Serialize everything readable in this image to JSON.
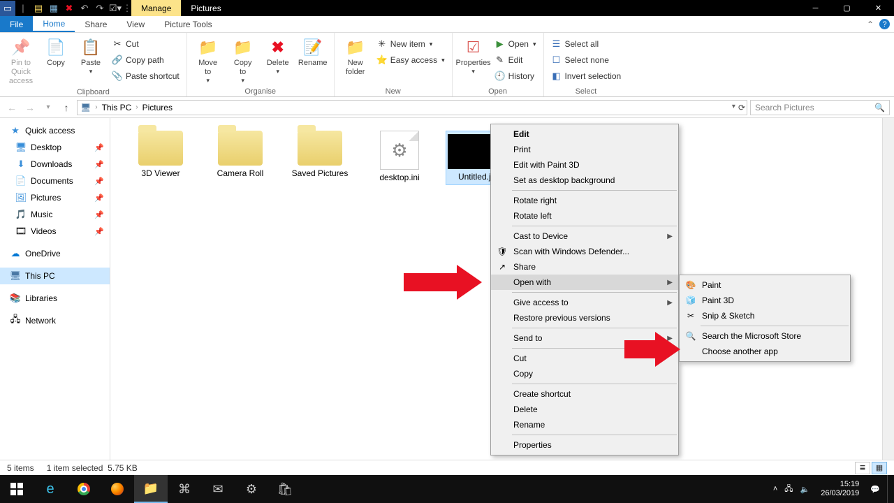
{
  "titlebar": {
    "context_group": "Manage",
    "title": "Pictures"
  },
  "menutabs": {
    "file": "File",
    "tabs": [
      "Home",
      "Share",
      "View",
      "Picture Tools"
    ],
    "active": "Home"
  },
  "ribbon": {
    "clipboard": {
      "title": "Clipboard",
      "pin": "Pin to Quick\naccess",
      "copy": "Copy",
      "paste": "Paste",
      "cut": "Cut",
      "copy_path": "Copy path",
      "paste_shortcut": "Paste shortcut"
    },
    "organise": {
      "title": "Organise",
      "move_to": "Move\nto",
      "copy_to": "Copy\nto",
      "delete": "Delete",
      "rename": "Rename"
    },
    "new": {
      "title": "New",
      "new_folder": "New\nfolder",
      "new_item": "New item",
      "easy_access": "Easy access"
    },
    "open": {
      "title": "Open",
      "properties": "Properties",
      "open": "Open",
      "edit": "Edit",
      "history": "History"
    },
    "select": {
      "title": "Select",
      "select_all": "Select all",
      "select_none": "Select none",
      "invert": "Invert selection"
    }
  },
  "address": {
    "crumbs": [
      "This PC",
      "Pictures"
    ],
    "search_placeholder": "Search Pictures"
  },
  "sidebar": {
    "quick_access": "Quick access",
    "items": [
      {
        "label": "Desktop",
        "icon": "🖥",
        "pin": true
      },
      {
        "label": "Downloads",
        "icon": "⬇",
        "pin": true
      },
      {
        "label": "Documents",
        "icon": "📄",
        "pin": true
      },
      {
        "label": "Pictures",
        "icon": "🖼",
        "pin": true
      },
      {
        "label": "Music",
        "icon": "🎵",
        "pin": true
      },
      {
        "label": "Videos",
        "icon": "🎞",
        "pin": true
      }
    ],
    "onedrive": "OneDrive",
    "this_pc": "This PC",
    "libraries": "Libraries",
    "network": "Network"
  },
  "files": {
    "items": [
      {
        "label": "3D Viewer",
        "type": "folder"
      },
      {
        "label": "Camera Roll",
        "type": "folder"
      },
      {
        "label": "Saved Pictures",
        "type": "folder"
      },
      {
        "label": "desktop.ini",
        "type": "file-gear"
      },
      {
        "label": "Untitled.jpg",
        "type": "image",
        "selected": true
      }
    ]
  },
  "context_menu": {
    "items": [
      {
        "label": "Edit",
        "bold": true
      },
      {
        "label": "Print"
      },
      {
        "label": "Edit with Paint 3D"
      },
      {
        "label": "Set as desktop background"
      },
      {
        "sep": true
      },
      {
        "label": "Rotate right"
      },
      {
        "label": "Rotate left"
      },
      {
        "sep": true
      },
      {
        "label": "Cast to Device",
        "arrow": true
      },
      {
        "label": "Scan with Windows Defender...",
        "icon": "🛡"
      },
      {
        "label": "Share",
        "icon": "↗"
      },
      {
        "label": "Open with",
        "arrow": true,
        "hov": true
      },
      {
        "sep": true
      },
      {
        "label": "Give access to",
        "arrow": true
      },
      {
        "label": "Restore previous versions"
      },
      {
        "sep": true
      },
      {
        "label": "Send to",
        "arrow": true
      },
      {
        "sep": true
      },
      {
        "label": "Cut"
      },
      {
        "label": "Copy"
      },
      {
        "sep": true
      },
      {
        "label": "Create shortcut"
      },
      {
        "label": "Delete"
      },
      {
        "label": "Rename"
      },
      {
        "sep": true
      },
      {
        "label": "Properties"
      }
    ]
  },
  "submenu": {
    "items": [
      {
        "label": "Paint",
        "icon": "🎨"
      },
      {
        "label": "Paint 3D",
        "icon": "🧊"
      },
      {
        "label": "Snip & Sketch",
        "icon": "✂"
      },
      {
        "sep": true
      },
      {
        "label": "Search the Microsoft Store",
        "icon": "🔍"
      },
      {
        "label": "Choose another app"
      }
    ]
  },
  "status": {
    "count": "5 items",
    "selected": "1 item selected",
    "size": "5.75 KB"
  },
  "taskbar": {
    "time": "15:19",
    "date": "26/03/2019"
  }
}
